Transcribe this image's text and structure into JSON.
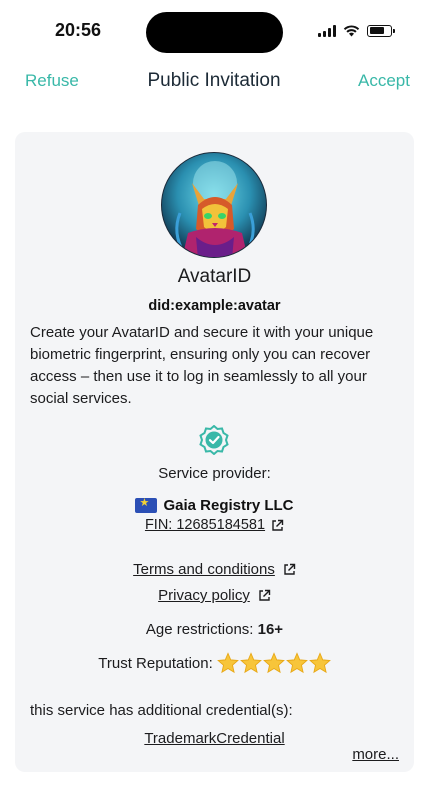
{
  "status_bar": {
    "time": "20:56",
    "battery_level_fraction": 0.72
  },
  "nav": {
    "refuse_label": "Refuse",
    "title": "Public Invitation",
    "accept_label": "Accept",
    "accent_color": "#39b8a8"
  },
  "service": {
    "name": "AvatarID",
    "did": "did:example:avatar",
    "description": "Create your AvatarID and secure it with your unique biometric fingerprint, ensuring only you can recover access – then use it to log in seamlessly to all your social services.",
    "provider_label": "Service provider:",
    "provider_name": "Gaia Registry LLC",
    "provider_flag": "eu-flag-icon",
    "fin": "FIN: 12685184581",
    "terms_label": "Terms and conditions",
    "privacy_label": "Privacy policy",
    "age_label": "Age restrictions:",
    "age_value": "16+",
    "trust_label": "Trust Reputation:",
    "trust_stars": 5,
    "trust_max": 5,
    "additional_label": "this service has additional credential(s):",
    "credential": "TrademarkCredential",
    "more_label": "more..."
  }
}
